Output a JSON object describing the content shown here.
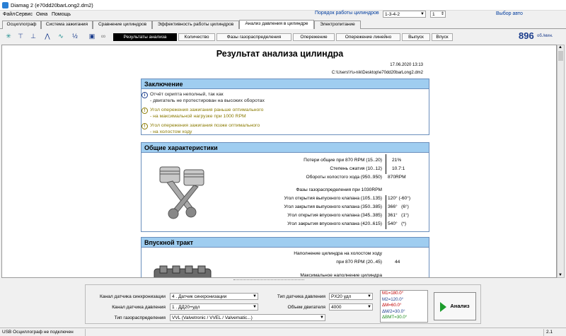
{
  "window": {
    "title": "Diamag 2 (e70dd20barLong2.dm2)"
  },
  "menu": [
    "Файл",
    "Сервис",
    "Окна",
    "Помощь"
  ],
  "header": {
    "order_label": "Порядок работы цилиндров",
    "order_value": "1-3-4-2",
    "cyl_value": "1",
    "auto_button": "Выбор авто"
  },
  "tabs": [
    {
      "label": "Осциллограф"
    },
    {
      "label": "Система зажигания"
    },
    {
      "label": "Сравнение цилиндров"
    },
    {
      "label": "Эффективность работы цилиндров"
    },
    {
      "label": "Анализ давления в цилиндре"
    },
    {
      "label": "Электропитание"
    }
  ],
  "subtabs": [
    {
      "label": "Результаты анализа"
    },
    {
      "label": "Количество"
    },
    {
      "label": "Фазы газораспределения"
    },
    {
      "label": "Опережение"
    },
    {
      "label": "Опережение линейно"
    },
    {
      "label": "Выпуск"
    },
    {
      "label": "Впуск"
    }
  ],
  "rpm": {
    "value": "896",
    "unit": "об./мин."
  },
  "report": {
    "title": "Результат анализа цилиндра",
    "date": "17.06.2020 13:13",
    "path": "C:\\Users\\Yu-nik\\Desktop\\e70dd20barLong2.dm2",
    "conclusion": {
      "header": "Заключение",
      "notes": [
        {
          "icon": "info-icon",
          "line1": "Отчёт скрипта неполный, так как",
          "line2": "- двигатель не протестирован на высоких оборотах"
        },
        {
          "icon": "warning-icon",
          "line1": "Угол опережения зажигания раньше оптимального",
          "line2": "- на максимальной нагрузке при 1000 RPM"
        },
        {
          "icon": "warning-icon",
          "line1": "Угол опережения зажигания позже оптимального",
          "line2": "- на холостом ходу"
        }
      ]
    },
    "general": {
      "header": "Общие характеристики",
      "rows": [
        {
          "label": "Потери общие при 870 RPM (15..20)",
          "value": "21%"
        },
        {
          "label": "Степень сжатия (10..12)",
          "value": "10.7:1"
        },
        {
          "label": "Обороты холостого хода (950..950)",
          "value": "870RPM"
        }
      ],
      "phases_title": "Фазы газораспределения при 1030RPM",
      "phases": [
        {
          "label": "Угол открытия выпускного клапана (105..135)",
          "value": "120° (-60°)"
        },
        {
          "label": "Угол закрытия выпускного клапана (350..385)",
          "value": "366°   (6°)"
        },
        {
          "label": "Угол открытия впускного клапана (345..385)",
          "value": "361°   (1°)"
        },
        {
          "label": "Угол закрытия впускного клапана (420..615)",
          "value": "540°   (*)"
        }
      ]
    },
    "intake": {
      "header": "Впускной тракт",
      "fill_idle_label1": "Наполнение цилиндра на холостом ходу",
      "fill_idle_label2": "при 870 RPM (20..45)",
      "fill_idle_value": "44",
      "fill_max_label": "Максимальное наполнение цилиндра"
    }
  },
  "bottom": {
    "sync_label": "Канал датчика синхронизации",
    "sync_value": "4 . Датчик синхронизации",
    "pressure_label": "Канал датчика давления",
    "pressure_value": "1 . ДД20+удл",
    "timing_label": "Тип газораспределения",
    "timing_value": "VVL (Valvetronic / VVEL / Valvematic...)",
    "sensor_type_label": "Тип датчика давления",
    "sensor_type_value": "PX20 удл",
    "volume_label": "Объем двигателя",
    "volume_value": "4000",
    "params": [
      "M1=180.0°",
      "M2=120.0°",
      "ΔM=60.0°",
      "ΔM/2=30.0°",
      "ΔBMT=30.0°"
    ],
    "param_colors": [
      "#c00000",
      "#1a3c8c",
      "#c00000",
      "#1a3c8c",
      "#1a8c1a"
    ],
    "analyze_label": "Анализ"
  },
  "status": {
    "left": "USB Осциллограф не подключен",
    "right": "2.1"
  }
}
